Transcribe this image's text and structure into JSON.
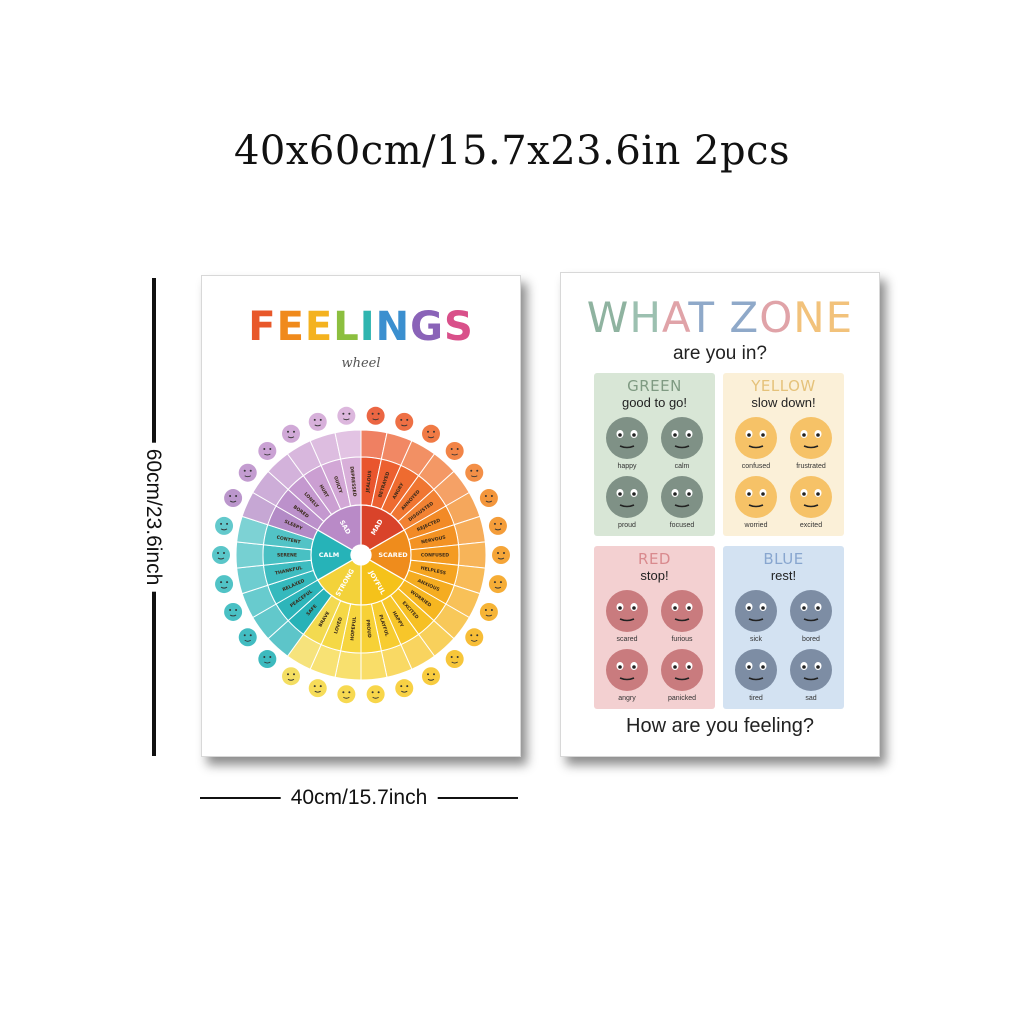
{
  "header": {
    "title": "40x60cm/15.7x23.6in 2pcs"
  },
  "dimensions": {
    "height_label": "60cm/23.6inch",
    "width_label": "40cm/15.7inch"
  },
  "feelings_poster": {
    "title_letters": [
      {
        "char": "F",
        "color": "#e8582a"
      },
      {
        "char": "E",
        "color": "#f08a1c"
      },
      {
        "char": "E",
        "color": "#f4b21f"
      },
      {
        "char": "L",
        "color": "#8cbf3f"
      },
      {
        "char": "I",
        "color": "#2fb5b0"
      },
      {
        "char": "N",
        "color": "#3b8fcf"
      },
      {
        "char": "G",
        "color": "#8a63b8"
      },
      {
        "char": "S",
        "color": "#d9508a"
      }
    ],
    "subtitle": "wheel",
    "wheel": {
      "core": [
        {
          "label": "MAD",
          "color": "#d9432a"
        },
        {
          "label": "SCARED",
          "color": "#ef8c1c"
        },
        {
          "label": "JOYFUL",
          "color": "#f5c21a"
        },
        {
          "label": "STRONG",
          "color": "#f3d23a"
        },
        {
          "label": "CALM",
          "color": "#26b3b8"
        },
        {
          "label": "SAD",
          "color": "#b98ac7"
        }
      ],
      "segments": [
        {
          "label": "JEALOUS",
          "color": "#e9552e"
        },
        {
          "label": "BETRAYED",
          "color": "#ec6030"
        },
        {
          "label": "ANGRY",
          "color": "#ee6b30"
        },
        {
          "label": "ANNOYED",
          "color": "#f07632"
        },
        {
          "label": "DISGUSTED",
          "color": "#f28233"
        },
        {
          "label": "REJECTED",
          "color": "#f28a26"
        },
        {
          "label": "NERVOUS",
          "color": "#f39224"
        },
        {
          "label": "CONFUSED",
          "color": "#f49b22"
        },
        {
          "label": "HELPLESS",
          "color": "#f5a420"
        },
        {
          "label": "ANXIOUS",
          "color": "#f5ac20"
        },
        {
          "label": "WORRIED",
          "color": "#f6b621"
        },
        {
          "label": "EXCITED",
          "color": "#f6c024"
        },
        {
          "label": "HAPPY",
          "color": "#f7c62a"
        },
        {
          "label": "PLAYFUL",
          "color": "#f7cc30"
        },
        {
          "label": "PROUD",
          "color": "#f7d136"
        },
        {
          "label": "HOPEFUL",
          "color": "#f6d53e"
        },
        {
          "label": "LOVED",
          "color": "#f5d846"
        },
        {
          "label": "BRAVE",
          "color": "#f3da50"
        },
        {
          "label": "SAFE",
          "color": "#27b2b7"
        },
        {
          "label": "PEACEFUL",
          "color": "#2db5ba"
        },
        {
          "label": "RELAXED",
          "color": "#35b9bd"
        },
        {
          "label": "THANKFUL",
          "color": "#3ebcc0"
        },
        {
          "label": "SERENE",
          "color": "#48c0c3"
        },
        {
          "label": "CONTENT",
          "color": "#52c3c6"
        },
        {
          "label": "SLEEPY",
          "color": "#b38ac6"
        },
        {
          "label": "BORED",
          "color": "#bc91cb"
        },
        {
          "label": "LONELY",
          "color": "#c498cf"
        },
        {
          "label": "HURT",
          "color": "#cb9fd2"
        },
        {
          "label": "GUILTY",
          "color": "#d2a7d6"
        },
        {
          "label": "DEPRESSED",
          "color": "#d8afd9"
        }
      ],
      "outer_ring_segments": 30
    }
  },
  "zones_poster": {
    "title_letters": [
      {
        "char": "W",
        "color": "#8fb3a0"
      },
      {
        "char": "H",
        "color": "#9cc0b0"
      },
      {
        "char": "A",
        "color": "#e0a3a8"
      },
      {
        "char": "T",
        "color": "#8fa9c9"
      },
      {
        "char": " ",
        "color": "#ffffff"
      },
      {
        "char": "Z",
        "color": "#8fa9c9"
      },
      {
        "char": "O",
        "color": "#e0a3a8"
      },
      {
        "char": "N",
        "color": "#f2c27b"
      },
      {
        "char": "E",
        "color": "#f2c27b"
      }
    ],
    "subtitle": "are you in?",
    "footer": "How are you feeling?",
    "zones": [
      {
        "name": "GREEN",
        "caption": "good to go!",
        "bg": "#d8e6d6",
        "name_color": "#7f9a82",
        "face_color": "#7f9186",
        "faces": [
          "happy",
          "calm",
          "proud",
          "focused"
        ]
      },
      {
        "name": "YELLOW",
        "caption": "slow down!",
        "bg": "#fbf0d8",
        "name_color": "#e5c27a",
        "face_color": "#f6c267",
        "faces": [
          "confused",
          "frustrated",
          "worried",
          "excited"
        ]
      },
      {
        "name": "RED",
        "caption": "stop!",
        "bg": "#f3d0d1",
        "name_color": "#d98a8e",
        "face_color": "#c97b7e",
        "faces": [
          "scared",
          "furious",
          "angry",
          "panicked"
        ]
      },
      {
        "name": "BLUE",
        "caption": "rest!",
        "bg": "#d3e2f2",
        "name_color": "#88a6cf",
        "face_color": "#7d8da4",
        "faces": [
          "sick",
          "bored",
          "tired",
          "sad"
        ]
      }
    ]
  }
}
